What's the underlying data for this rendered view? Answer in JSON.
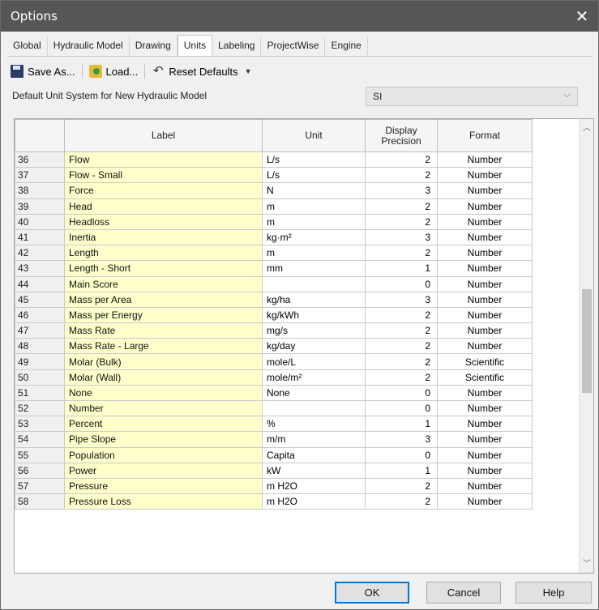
{
  "window": {
    "title": "Options"
  },
  "tabs": [
    {
      "label": "Global",
      "active": false
    },
    {
      "label": "Hydraulic Model",
      "active": false
    },
    {
      "label": "Drawing",
      "active": false
    },
    {
      "label": "Units",
      "active": true
    },
    {
      "label": "Labeling",
      "active": false
    },
    {
      "label": "ProjectWise",
      "active": false
    },
    {
      "label": "Engine",
      "active": false
    }
  ],
  "toolbar": {
    "save_label": "Save As...",
    "load_label": "Load...",
    "reset_label": "Reset Defaults"
  },
  "unit_system": {
    "label": "Default Unit System for New Hydraulic Model",
    "value": "SI"
  },
  "grid": {
    "headers": {
      "label": "Label",
      "unit": "Unit",
      "precision": "Display Precision",
      "format": "Format"
    },
    "rows": [
      {
        "num": "36",
        "label": "Flow",
        "unit": "L/s",
        "precision": "2",
        "format": "Number"
      },
      {
        "num": "37",
        "label": "Flow - Small",
        "unit": "L/s",
        "precision": "2",
        "format": "Number"
      },
      {
        "num": "38",
        "label": "Force",
        "unit": "N",
        "precision": "3",
        "format": "Number"
      },
      {
        "num": "39",
        "label": "Head",
        "unit": "m",
        "precision": "2",
        "format": "Number"
      },
      {
        "num": "40",
        "label": "Headloss",
        "unit": "m",
        "precision": "2",
        "format": "Number"
      },
      {
        "num": "41",
        "label": "Inertia",
        "unit": "kg·m²",
        "precision": "3",
        "format": "Number"
      },
      {
        "num": "42",
        "label": "Length",
        "unit": "m",
        "precision": "2",
        "format": "Number"
      },
      {
        "num": "43",
        "label": "Length - Short",
        "unit": "mm",
        "precision": "1",
        "format": "Number"
      },
      {
        "num": "44",
        "label": "Main Score",
        "unit": "",
        "precision": "0",
        "format": "Number"
      },
      {
        "num": "45",
        "label": "Mass per Area",
        "unit": "kg/ha",
        "precision": "3",
        "format": "Number"
      },
      {
        "num": "46",
        "label": "Mass per Energy",
        "unit": "kg/kWh",
        "precision": "2",
        "format": "Number"
      },
      {
        "num": "47",
        "label": "Mass Rate",
        "unit": "mg/s",
        "precision": "2",
        "format": "Number"
      },
      {
        "num": "48",
        "label": "Mass Rate - Large",
        "unit": "kg/day",
        "precision": "2",
        "format": "Number"
      },
      {
        "num": "49",
        "label": "Molar (Bulk)",
        "unit": "mole/L",
        "precision": "2",
        "format": "Scientific"
      },
      {
        "num": "50",
        "label": "Molar (Wall)",
        "unit": "mole/m²",
        "precision": "2",
        "format": "Scientific"
      },
      {
        "num": "51",
        "label": "None",
        "unit": "None",
        "precision": "0",
        "format": "Number"
      },
      {
        "num": "52",
        "label": "Number",
        "unit": "",
        "precision": "0",
        "format": "Number"
      },
      {
        "num": "53",
        "label": "Percent",
        "unit": "%",
        "precision": "1",
        "format": "Number"
      },
      {
        "num": "54",
        "label": "Pipe Slope",
        "unit": "m/m",
        "precision": "3",
        "format": "Number"
      },
      {
        "num": "55",
        "label": "Population",
        "unit": "Capita",
        "precision": "0",
        "format": "Number"
      },
      {
        "num": "56",
        "label": "Power",
        "unit": "kW",
        "precision": "1",
        "format": "Number"
      },
      {
        "num": "57",
        "label": "Pressure",
        "unit": "m H2O",
        "precision": "2",
        "format": "Number"
      },
      {
        "num": "58",
        "label": "Pressure Loss",
        "unit": "m H2O",
        "precision": "2",
        "format": "Number"
      }
    ]
  },
  "buttons": {
    "ok": "OK",
    "cancel": "Cancel",
    "help": "Help"
  }
}
